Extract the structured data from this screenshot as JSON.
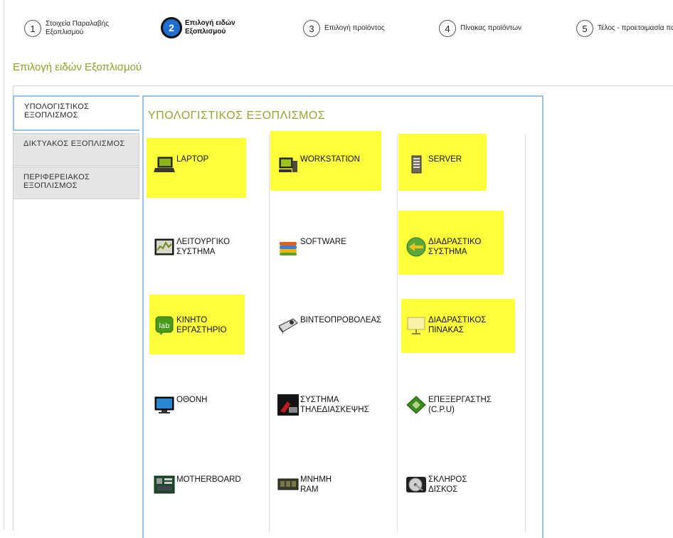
{
  "wizard": {
    "steps": [
      {
        "num": "1",
        "label": "Στοιχεία Παραλαβής Εξοπλισμού"
      },
      {
        "num": "2",
        "label": "Επιλογή ειδών Εξοπλισμού"
      },
      {
        "num": "3",
        "label": "Επιλογή προϊόντος"
      },
      {
        "num": "4",
        "label": "Πίνακας προϊόντων"
      },
      {
        "num": "5",
        "label": "Τέλος - προετοιμασία παραλαβής"
      }
    ]
  },
  "page_title": "Επιλογή ειδών Εξοπλισμού",
  "tabs": [
    {
      "label": "ΥΠΟΛΟΓΙΣΤΙΚΟΣ ΕΞΟΠΛΙΣΜΟΣ"
    },
    {
      "label": "ΔΙΚΤΥΑΚΟΣ ΕΞΟΠΛΙΣΜΟΣ"
    },
    {
      "label": "ΠΕΡΙΦΕΡΕΙΑΚΟΣ ΕΞΟΠΛΙΣΜΟΣ"
    }
  ],
  "panel_title": "ΥΠΟΛΟΓΙΣΤΙΚΟΣ ΕΞΟΠΛΙΣΜΟΣ",
  "items": [
    {
      "label": "LAPTOP",
      "icon": "laptop-icon",
      "selected": true
    },
    {
      "label": "WORKSTATION",
      "icon": "workstation-icon",
      "selected": true
    },
    {
      "label": "SERVER",
      "icon": "server-icon",
      "selected": true
    },
    {
      "label": "ΛΕΙΤΟΥΡΓΙΚΟ ΣΥΣΤΗΜΑ",
      "icon": "operating-system-icon",
      "selected": false
    },
    {
      "label": "SOFTWARE",
      "icon": "software-icon",
      "selected": false
    },
    {
      "label": "ΔΙΑΔΡΑΣΤΙΚΟ ΣΥΣΤΗΜΑ",
      "icon": "interactive-system-icon",
      "selected": true
    },
    {
      "label": "ΚΙΝΗΤΟ ΕΡΓΑΣΤΗΡΙΟ",
      "icon": "mobile-lab-icon",
      "selected": true
    },
    {
      "label": "ΒΙΝΤΕΟΠΡΟΒΟΛΕΑΣ",
      "icon": "projector-icon",
      "selected": false
    },
    {
      "label": "ΔΙΑΔΡΑΣΤΙΚΟΣ ΠΙΝΑΚΑΣ",
      "icon": "interactive-board-icon",
      "selected": true
    },
    {
      "label": "ΟΘΟΝΗ",
      "icon": "monitor-icon",
      "selected": false
    },
    {
      "label": "ΣΥΣΤΗΜΑ ΤΗΛΕΔΙΑΣΚΕΨΗΣ",
      "icon": "teleconference-icon",
      "selected": false
    },
    {
      "label": "ΕΠΕΞΕΡΓΑΣΤΗΣ (C.P.U)",
      "icon": "cpu-icon",
      "selected": false
    },
    {
      "label": "MOTHERBOARD",
      "icon": "motherboard-icon",
      "selected": false
    },
    {
      "label": "ΜΝΗΜΗ RAM",
      "icon": "ram-icon",
      "selected": false
    },
    {
      "label": "ΣΚΛΗΡΟΣ ΔΙΣΚΟΣ",
      "icon": "hard-disk-icon",
      "selected": false
    }
  ],
  "colors": {
    "highlight": "#ffff3c",
    "accent": "#1f6fd1",
    "title": "#8aa224"
  }
}
